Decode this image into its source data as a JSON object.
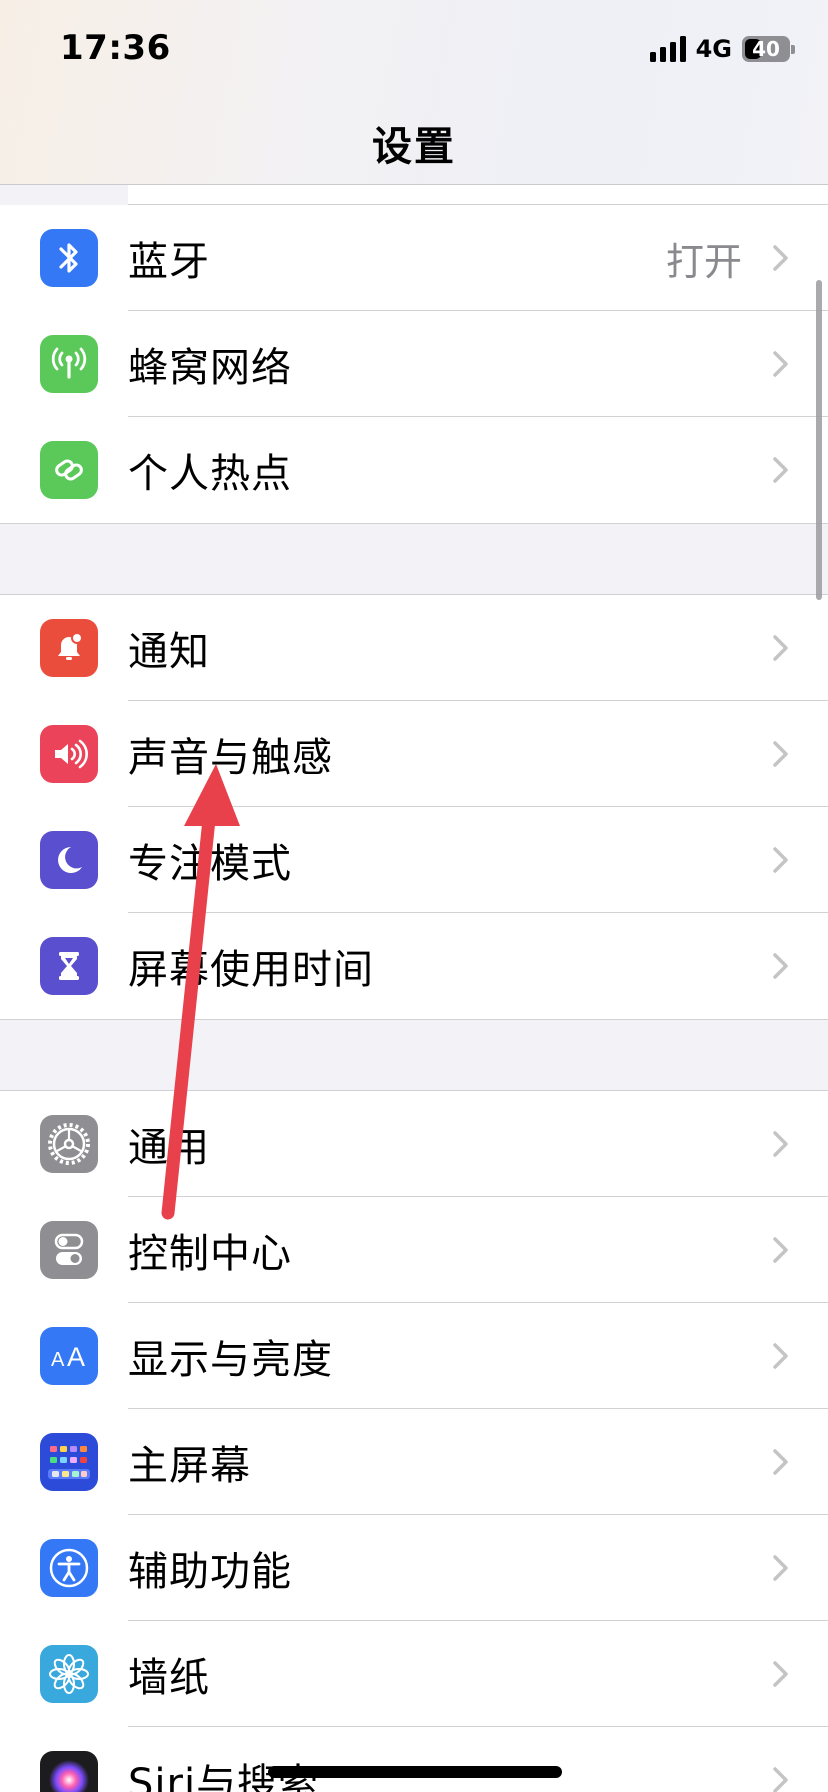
{
  "status_bar": {
    "time": "17:36",
    "network": "4G",
    "battery": "40",
    "battery_level": 0.4
  },
  "header": {
    "title": "设置"
  },
  "groups": [
    {
      "items": [
        {
          "label": "蓝牙",
          "value": "打开",
          "icon": "bluetooth-icon",
          "color": "#3478f6"
        },
        {
          "label": "蜂窝网络",
          "value": "",
          "icon": "cellular-antenna-icon",
          "color": "#5ac95a"
        },
        {
          "label": "个人热点",
          "value": "",
          "icon": "hotspot-link-icon",
          "color": "#5ac95a"
        }
      ]
    },
    {
      "items": [
        {
          "label": "通知",
          "icon": "notification-bell-icon",
          "color": "#eb4d3d"
        },
        {
          "label": "声音与触感",
          "icon": "speaker-icon",
          "color": "#eb445a"
        },
        {
          "label": "专注模式",
          "icon": "moon-icon",
          "color": "#5a4fcf"
        },
        {
          "label": "屏幕使用时间",
          "icon": "hourglass-icon",
          "color": "#5a4fcf"
        }
      ]
    },
    {
      "items": [
        {
          "label": "通用",
          "icon": "gear-icon",
          "color": "#8e8e93"
        },
        {
          "label": "控制中心",
          "icon": "toggles-icon",
          "color": "#8e8e93"
        },
        {
          "label": "显示与亮度",
          "icon": "text-size-icon",
          "color": "#3478f6"
        },
        {
          "label": "主屏幕",
          "icon": "home-grid-icon",
          "color": "#2b4bd8"
        },
        {
          "label": "辅助功能",
          "icon": "accessibility-icon",
          "color": "#3478f6"
        },
        {
          "label": "墙纸",
          "icon": "flower-icon",
          "color": "#38a8dd"
        },
        {
          "label": "Siri与搜索",
          "icon": "siri-icon",
          "color": "#1c1c1e"
        }
      ]
    }
  ],
  "annotation": {
    "color": "#e8414b"
  }
}
